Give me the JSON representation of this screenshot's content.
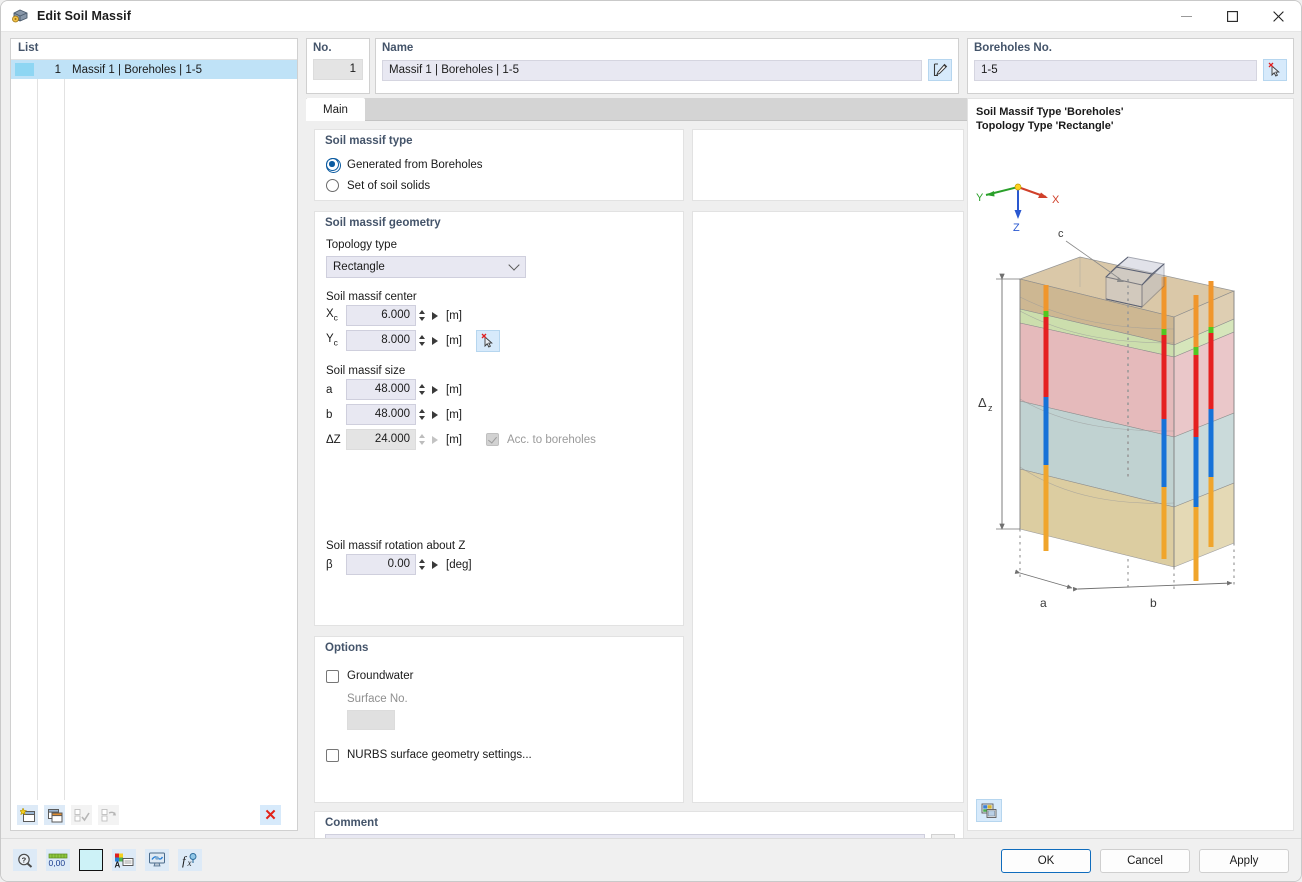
{
  "window": {
    "title": "Edit Soil Massif",
    "icon": "soil-massif-icon",
    "minimize": "—",
    "maximize": "□",
    "close": "✕"
  },
  "list": {
    "header": "List",
    "rows": [
      {
        "number": "1",
        "label": "Massif 1 | Boreholes | 1-5",
        "swatch_color": "#8ed6f3",
        "selected": true
      }
    ],
    "toolbar": [
      {
        "name": "new-item-button",
        "icon": "new-window-icon",
        "enabled": true
      },
      {
        "name": "copy-item-button",
        "icon": "copy-window-icon",
        "enabled": true
      },
      {
        "name": "select-all-button",
        "icon": "check-all-icon",
        "enabled": false
      },
      {
        "name": "invert-selection-button",
        "icon": "invert-check-icon",
        "enabled": false
      },
      {
        "name": "delete-item-button",
        "icon": "red-cross-icon",
        "label": "✕",
        "enabled": true
      }
    ]
  },
  "header": {
    "no_label": "No.",
    "no_value": "1",
    "name_label": "Name",
    "name_value": "Massif 1 | Boreholes | 1-5",
    "name_edit_icon": "edit-pencil-icon",
    "boreholes_label": "Boreholes No.",
    "boreholes_value": "1-5",
    "boreholes_pick_icon": "pick-cursor-icon"
  },
  "tabs": [
    {
      "label": "Main",
      "active": true
    }
  ],
  "soil_massif_type": {
    "title": "Soil massif type",
    "options": [
      {
        "label": "Generated from Boreholes",
        "selected": true
      },
      {
        "label": "Set of soil solids",
        "selected": false
      }
    ]
  },
  "soil_massif_geometry": {
    "title": "Soil massif geometry",
    "topology_label": "Topology type",
    "topology_value": "Rectangle",
    "center_label": "Soil massif center",
    "center_fields": [
      {
        "symbol": "X",
        "sub": "c",
        "value": "6.000",
        "unit": "[m]",
        "enabled": true
      },
      {
        "symbol": "Y",
        "sub": "c",
        "value": "8.000",
        "unit": "[m]",
        "enabled": true
      }
    ],
    "center_pick_icon": "pick-cursor-icon",
    "size_label": "Soil massif size",
    "size_fields": [
      {
        "symbol": "a",
        "sub": "",
        "value": "48.000",
        "unit": "[m]",
        "enabled": true
      },
      {
        "symbol": "b",
        "sub": "",
        "value": "48.000",
        "unit": "[m]",
        "enabled": true
      },
      {
        "symbol": "ΔZ",
        "sub": "",
        "value": "24.000",
        "unit": "[m]",
        "enabled": false
      }
    ],
    "acc_to_boreholes_label": "Acc. to boreholes",
    "acc_to_boreholes_checked": true,
    "rotation_label": "Soil massif rotation about Z",
    "rotation_field": {
      "symbol": "β",
      "value": "0.00",
      "unit": "[deg]"
    }
  },
  "options": {
    "title": "Options",
    "groundwater_label": "Groundwater",
    "groundwater_checked": false,
    "surface_no_label": "Surface No.",
    "surface_no_value": "",
    "nurbs_label": "NURBS surface geometry settings...",
    "nurbs_checked": false
  },
  "comment": {
    "title": "Comment",
    "value": "",
    "copy_icon": "copy-comment-icon"
  },
  "preview": {
    "line1": "Soil Massif Type 'Boreholes'",
    "line2": "Topology Type 'Rectangle'",
    "axis": {
      "x": "X",
      "y": "Y",
      "z": "Z"
    },
    "dimensions": {
      "dz": "Δ",
      "dz_sub": "z",
      "a": "a",
      "b": "b",
      "c": "c"
    },
    "settings_icon": "image-settings-icon",
    "colors": {
      "layer1": "#d6bf9a",
      "layer2": "#c9d9a8",
      "layer3": "#e0aeb0",
      "layer4": "#b2c9c9",
      "layer5": "#d9c68f",
      "borehole_orange": "#f0962c",
      "borehole_red": "#e52020",
      "borehole_blue": "#1772d8",
      "borehole_green": "#52c820",
      "axis_x": "#d0402a",
      "axis_y": "#2aa02a",
      "axis_z": "#2a58d0"
    }
  },
  "footer": {
    "icons": [
      {
        "name": "help-magnifier-icon"
      },
      {
        "name": "number-format-icon",
        "text": "0,00"
      },
      {
        "name": "color-swatch-icon"
      },
      {
        "name": "label-settings-icon"
      },
      {
        "name": "display-settings-icon"
      },
      {
        "name": "function-icon",
        "text": "f"
      }
    ],
    "buttons": [
      {
        "label": "OK",
        "primary": true
      },
      {
        "label": "Cancel",
        "primary": false
      },
      {
        "label": "Apply",
        "primary": false
      }
    ]
  }
}
